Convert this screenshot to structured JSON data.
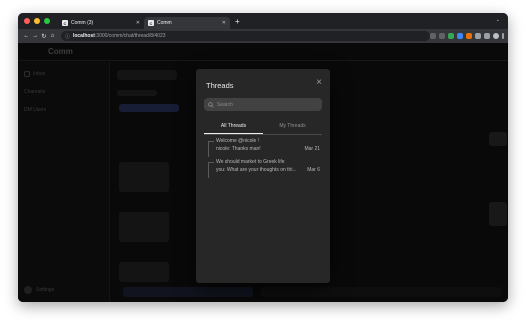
{
  "browser": {
    "tabs": [
      {
        "label": "Comm (3)",
        "favicon": "C"
      },
      {
        "label": "Comm",
        "favicon": "C"
      }
    ],
    "url_host": "localhost",
    "url_path": ":3000/comm/chat/thread/8/4023",
    "traffic_colors": [
      "#ff5f57",
      "#febc2e",
      "#28c840"
    ]
  },
  "app": {
    "header_title": "Comm",
    "sidebar_items": [
      "Inbox",
      "Channels",
      "DM Users"
    ],
    "sidebar_bottom": "Settings"
  },
  "modal": {
    "title": "Threads",
    "close_glyph": "×",
    "search_placeholder": "Search",
    "tabs": [
      "All Threads",
      "My Threads"
    ],
    "threads": [
      {
        "line1": "Welcome @nicole !",
        "line2": "nicole: Thanks man!",
        "date": "Mar 21"
      },
      {
        "line1": "We should market to Greek life",
        "line2": "you: What are your thoughts on thi...",
        "date": "Mar 6"
      }
    ]
  }
}
